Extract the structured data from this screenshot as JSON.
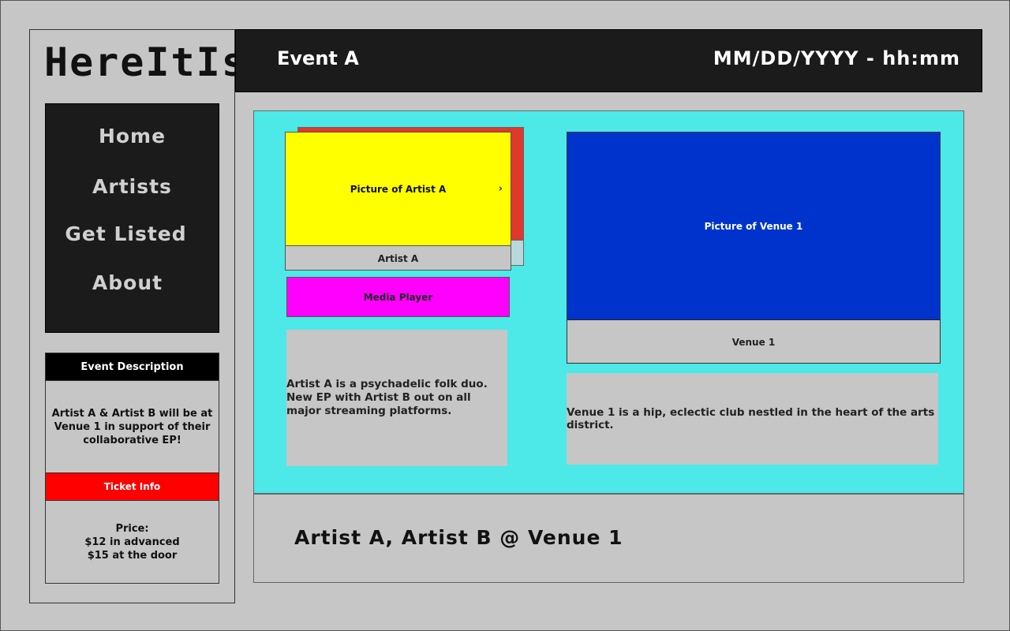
{
  "app": {
    "logo": "HereItIs"
  },
  "nav": {
    "items": [
      {
        "label": "Home"
      },
      {
        "label": "Artists"
      },
      {
        "label": "Get Listed"
      },
      {
        "label": "About"
      }
    ]
  },
  "event_description": {
    "heading": "Event Description",
    "text": "Artist A & Artist B will be at Venue 1 in support of their collaborative EP!"
  },
  "ticket_info": {
    "heading": "Ticket Info",
    "price_label": "Price:",
    "advanced": "$12 in advanced",
    "door": "$15 at the door"
  },
  "header": {
    "title": "Event A",
    "datetime": "MM/DD/YYYY - hh:mm"
  },
  "artist": {
    "picture_label": "Picture of Artist A",
    "next_icon": "chevron-right-icon",
    "next_glyph": "›",
    "name": "Artist A",
    "media_player": "Media Player",
    "bio": "Artist A is a psychadelic folk duo. New EP with Artist B out on all major streaming platforms."
  },
  "venue": {
    "picture_label": "Picture of Venue 1",
    "name": "Venue 1",
    "bio": "Venue 1 is a hip, eclectic club nestled in the heart of the arts district."
  },
  "footer": {
    "lineup": "Artist A, Artist B @ Venue 1"
  },
  "colors": {
    "background": "#c6c6c6",
    "dark_panel": "#1b1b1b",
    "main_panel": "#4de8e8",
    "artist_picture": "#ffff00",
    "artist_card_back": "#e0382c",
    "media_player": "#ff00ff",
    "venue_picture": "#0033cc",
    "ticket_header": "#ff0000"
  }
}
